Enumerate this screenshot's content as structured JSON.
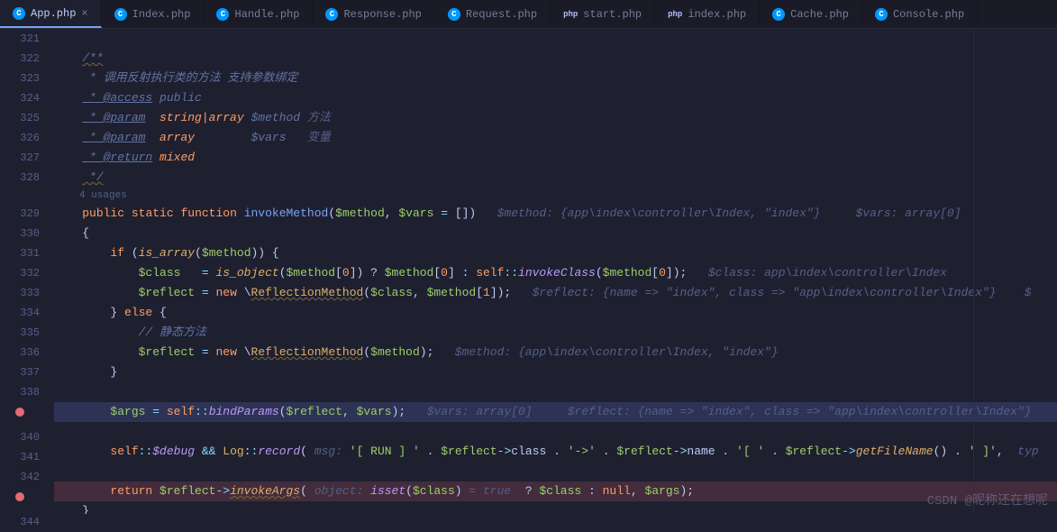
{
  "tabs": [
    {
      "icon": "C",
      "label": "App.php",
      "active": true,
      "close": true
    },
    {
      "icon": "C",
      "label": "Index.php"
    },
    {
      "icon": "C",
      "label": "Handle.php"
    },
    {
      "icon": "C",
      "label": "Response.php"
    },
    {
      "icon": "C",
      "label": "Request.php"
    },
    {
      "icon": "php",
      "label": "start.php"
    },
    {
      "icon": "php",
      "label": "index.php"
    },
    {
      "icon": "C",
      "label": "Cache.php"
    },
    {
      "icon": "C",
      "label": "Console.php"
    }
  ],
  "gutter": [
    "321",
    "322",
    "323",
    "324",
    "325",
    "326",
    "327",
    "328",
    "",
    "329",
    "330",
    "331",
    "332",
    "333",
    "334",
    "335",
    "336",
    "337",
    "338",
    "bp",
    "340",
    "341",
    "342",
    "bp",
    "344"
  ],
  "usages": "4 usages",
  "code": {
    "doc_open": "/**",
    "doc_l1": " * 调用反射执行类的方法 支持参数绑定",
    "doc_l2_k": " * @access",
    "doc_l2_v": "public",
    "doc_l3_k": " * @param",
    "doc_l3_t": "string|array",
    "doc_l3_v": "$method",
    "doc_l3_c": "方法",
    "doc_l4_k": " * @param",
    "doc_l4_t": "array",
    "doc_l4_v": "$vars",
    "doc_l4_c": "变量",
    "doc_l5_k": " * @return",
    "doc_l5_v": "mixed",
    "doc_close": " */",
    "fn_sig_kw1": "public",
    "fn_sig_kw2": "static",
    "fn_sig_kw3": "function",
    "fn_name": "invokeMethod",
    "fn_p1": "$method",
    "fn_p2": "$vars",
    "fn_p2_def": "[]",
    "hint_329": "$method: {app\\index\\controller\\Index, \"index\"}     $vars: array[0]",
    "brace_open": "{",
    "if_kw": "if",
    "if_fn": "is_array",
    "if_arg": "$method",
    "l332_v1": "$class",
    "l332_fn": "is_object",
    "l332_m": "$method",
    "l332_idx": "0",
    "l332_self": "self",
    "l332_inv": "invokeClass",
    "hint_332": "$class: app\\index\\controller\\Index",
    "l333_v": "$reflect",
    "l333_new": "new",
    "l333_cls": "ReflectionMethod",
    "l333_a1": "$class",
    "l333_a2": "$method",
    "l333_idx": "1",
    "hint_333": "$reflect: {name => \"index\", class => \"app\\index\\controller\\Index\"}    $",
    "else_kw": "else",
    "l335_c": "// 静态方法",
    "l336_v": "$reflect",
    "l336_cls": "ReflectionMethod",
    "l336_a": "$method",
    "hint_336": "$method: {app\\index\\controller\\Index, \"index\"}",
    "l339_v": "$args",
    "l339_self": "self",
    "l339_fn": "bindParams",
    "l339_a1": "$reflect",
    "l339_a2": "$vars",
    "hint_339": "$vars: array[0]     $reflect: {name => \"index\", class => \"app\\index\\controller\\Index\"}",
    "l341_self": "self",
    "l341_debug": "$debug",
    "l341_log": "Log",
    "l341_rec": "record",
    "l341_hint1": "msg:",
    "l341_s1": "'[ RUN ] '",
    "l341_r": "$reflect",
    "l341_cls": "class",
    "l341_arrow": "'->'",
    "l341_name": "name",
    "l341_b1": "'[ '",
    "l341_gf": "getFileName",
    "l341_b2": "' ]'",
    "l341_end": "typ",
    "l343_ret": "return",
    "l343_r": "$reflect",
    "l343_inv": "invokeArgs",
    "l343_hint": "object:",
    "l343_isset": "isset",
    "l343_c": "$class",
    "l343_true": "= true",
    "l343_null": "null",
    "l343_args": "$args",
    "brace_close": "}"
  },
  "watermark": "CSDN @昵称还在想呢"
}
